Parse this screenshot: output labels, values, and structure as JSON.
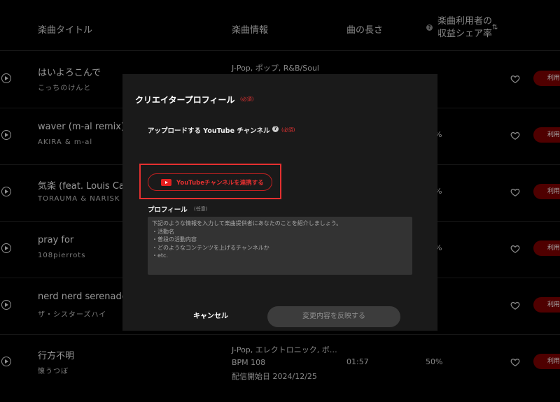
{
  "header": {
    "title": "楽曲タイトル",
    "info": "楽曲情報",
    "length": "曲の長さ",
    "share_line1": "楽曲利用者の",
    "share_line2": "収益シェア率",
    "help_icon": "?",
    "sort_icon": "⇅"
  },
  "rows": [
    {
      "title": "はいよろこんで",
      "artist": "こっちのけんと",
      "info_line1": "J-Pop, ポップ, R&B/Soul",
      "use_label": "利用"
    },
    {
      "title": "waver (m-al remix)",
      "artist": "AKIRA & m-al",
      "share_partial": "%",
      "use_label": "利用"
    },
    {
      "title": "気楽 (feat. Louis Cañ",
      "artist": "TORAUMA & NARISK",
      "share_partial": "%",
      "use_label": "利用"
    },
    {
      "title": "pray for",
      "artist": "108pierrots",
      "share_partial": "%",
      "use_label": "利用"
    },
    {
      "title": "nerd nerd serenade",
      "artist": "ザ・シスターズハイ",
      "use_label": "利用"
    },
    {
      "title": "行方不明",
      "artist": "懐うつぼ",
      "info_line1": "J-Pop, エレクトロニック, ボ…",
      "info_line2": "BPM 108",
      "info_line3": "配信開始日 2024/12/25",
      "length": "01:57",
      "share": "50%",
      "use_label": "利用"
    }
  ],
  "modal": {
    "title": "クリエイタープロフィール",
    "required": "(必須)",
    "youtube_label": "アップロードする YouTube チャンネル",
    "youtube_help": "?",
    "youtube_required": "(必須)",
    "connect_button": "YouTubeチャンネルを連携する",
    "profile_label": "プロフィール",
    "profile_optional": "(任意)",
    "profile_placeholder": "下記のような情報を入力して楽曲提供者にあなたのことを紹介しましょう。\n・活動名\n・普段の活動内容\n・どのようなコンテンツを上げるチャンネルか\n・etc.",
    "cancel": "キャンセル",
    "apply": "変更内容を反映する"
  },
  "colors": {
    "accent_red": "#e53030",
    "use_button_bg": "#7a0000",
    "modal_bg": "#1a1a1a"
  }
}
